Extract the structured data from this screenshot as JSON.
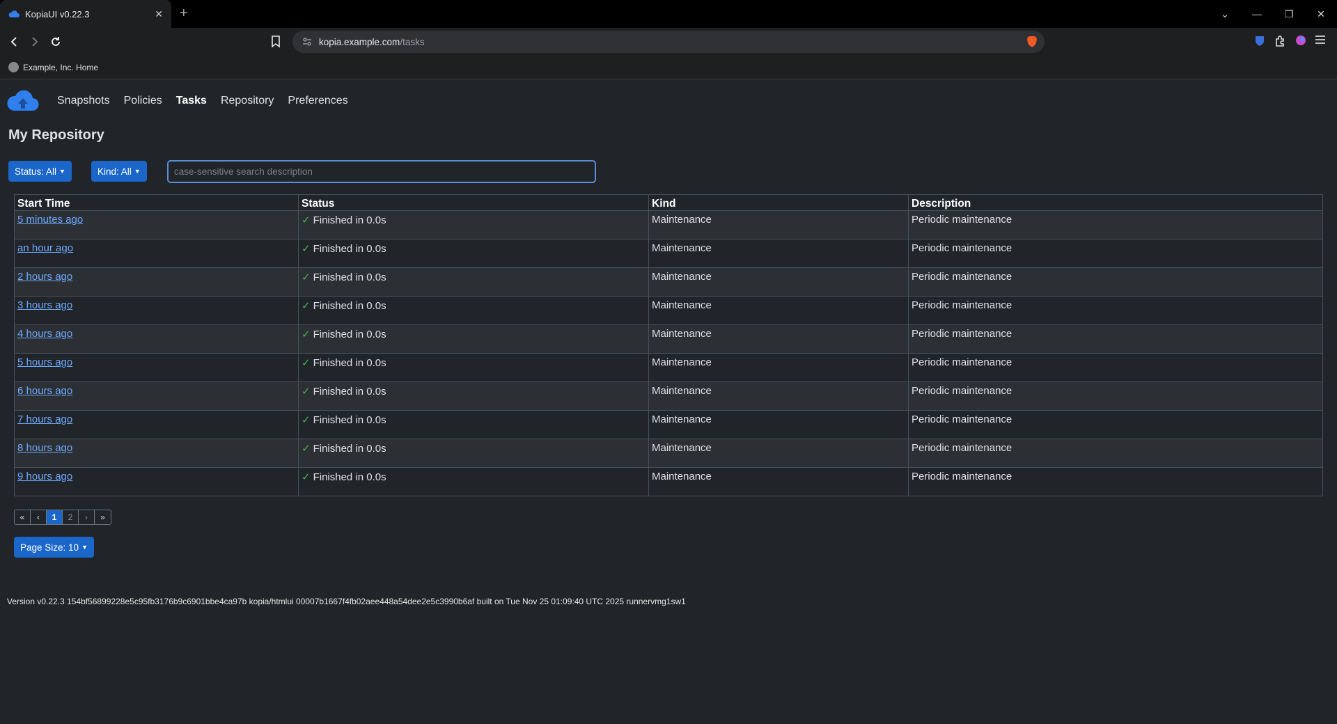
{
  "browser": {
    "tab_title": "KopiaUI v0.22.3",
    "tab_close": "✕",
    "new_tab": "+",
    "url_host": "kopia.example.com",
    "url_path": "/tasks",
    "bookmark_label": "Example, Inc. Home",
    "window_controls": [
      "⌄",
      "—",
      "❐",
      "✕"
    ]
  },
  "app": {
    "nav": [
      "Snapshots",
      "Policies",
      "Tasks",
      "Repository",
      "Preferences"
    ],
    "active_nav": "Tasks",
    "repo_title": "My Repository",
    "status_filter": "Status: All",
    "kind_filter": "Kind: All",
    "search_placeholder": "case-sensitive search description",
    "page_size": "Page Size: 10",
    "footer": "Version v0.22.3 154bf56899228e5c95fb3176b9c6901bbe4ca97b kopia/htmlui 00007b1667f4fb02aee448a54dee2e5c3990b6af built on Tue Nov 25 01:09:40 UTC 2025 runnervmg1sw1"
  },
  "table": {
    "columns": [
      "Start Time",
      "Status",
      "Kind",
      "Description"
    ],
    "rows": [
      {
        "start": "5 minutes ago",
        "status": "Finished in 0.0s",
        "kind": "Maintenance",
        "description": "Periodic maintenance"
      },
      {
        "start": "an hour ago",
        "status": "Finished in 0.0s",
        "kind": "Maintenance",
        "description": "Periodic maintenance"
      },
      {
        "start": "2 hours ago",
        "status": "Finished in 0.0s",
        "kind": "Maintenance",
        "description": "Periodic maintenance"
      },
      {
        "start": "3 hours ago",
        "status": "Finished in 0.0s",
        "kind": "Maintenance",
        "description": "Periodic maintenance"
      },
      {
        "start": "4 hours ago",
        "status": "Finished in 0.0s",
        "kind": "Maintenance",
        "description": "Periodic maintenance"
      },
      {
        "start": "5 hours ago",
        "status": "Finished in 0.0s",
        "kind": "Maintenance",
        "description": "Periodic maintenance"
      },
      {
        "start": "6 hours ago",
        "status": "Finished in 0.0s",
        "kind": "Maintenance",
        "description": "Periodic maintenance"
      },
      {
        "start": "7 hours ago",
        "status": "Finished in 0.0s",
        "kind": "Maintenance",
        "description": "Periodic maintenance"
      },
      {
        "start": "8 hours ago",
        "status": "Finished in 0.0s",
        "kind": "Maintenance",
        "description": "Periodic maintenance"
      },
      {
        "start": "9 hours ago",
        "status": "Finished in 0.0s",
        "kind": "Maintenance",
        "description": "Periodic maintenance"
      }
    ]
  },
  "pagination": {
    "first": "«",
    "prev": "‹",
    "pages": [
      "1",
      "2"
    ],
    "current": "1",
    "next": "›",
    "last": "»"
  },
  "icons": {
    "check_glyph": "✓",
    "accent": "#1b66c9",
    "link": "#6ea8fe",
    "success": "#3fb950"
  }
}
